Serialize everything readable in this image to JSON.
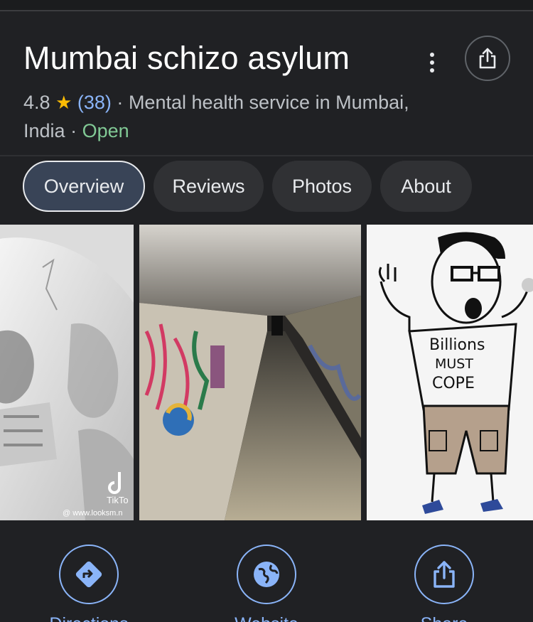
{
  "place": {
    "title": "Mumbai schizo asylum",
    "rating": "4.8",
    "review_count": "(38)",
    "category": "Mental health service in Mumbai,",
    "region": "India",
    "status": "Open",
    "separator": "·"
  },
  "header": {
    "more_icon": "more-vert-icon",
    "share_icon": "share-icon"
  },
  "tabs": [
    {
      "label": "Overview",
      "active": true
    },
    {
      "label": "Reviews",
      "active": false
    },
    {
      "label": "Photos",
      "active": false
    },
    {
      "label": "About",
      "active": false
    }
  ],
  "photos": {
    "skull_watermark_app": "TikTo",
    "skull_watermark_url": "@ www.looksm.n",
    "meme_shirt_line1": "Billions",
    "meme_shirt_line2": "MUST",
    "meme_shirt_line3": "COPE"
  },
  "actions": [
    {
      "label": "Directions",
      "icon": "directions-icon"
    },
    {
      "label": "Website",
      "icon": "globe-icon"
    },
    {
      "label": "Share",
      "icon": "share-icon"
    }
  ],
  "colors": {
    "background": "#202124",
    "accent": "#8ab4f8",
    "open": "#81c995",
    "star": "#fbbc04",
    "active_tab": "#394457"
  }
}
